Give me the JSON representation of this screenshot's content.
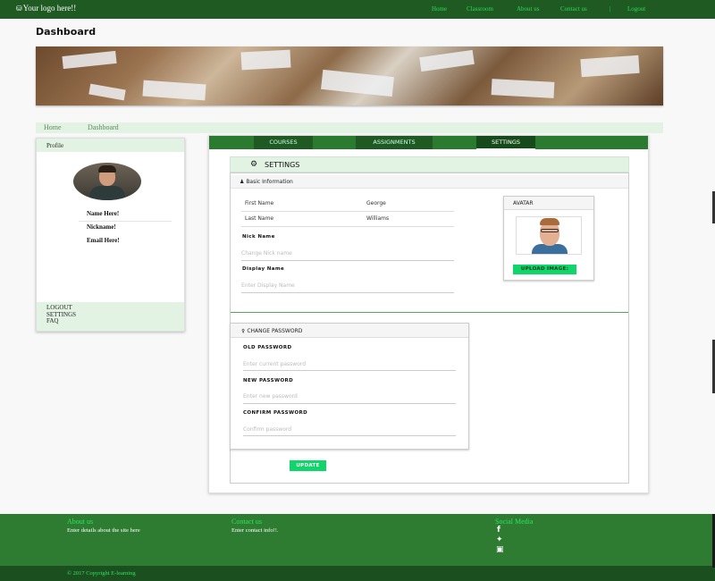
{
  "header": {
    "logo_icon": "car-icon",
    "logo_text": "Your logo here!!",
    "nav": [
      "Home",
      "Classroom",
      "About us",
      "Contact us",
      "|",
      "Logout"
    ]
  },
  "page_title": "Dashboard",
  "breadcrumb": [
    "Home",
    "Dashboard"
  ],
  "profile": {
    "heading": "Profile",
    "name": "Name Here!",
    "nickname": "Nickname!",
    "email": "Email Here!",
    "links": [
      "LOGOUT",
      "SETTINGS",
      "FAQ"
    ]
  },
  "tabs": [
    {
      "label": "COURSES",
      "active": false
    },
    {
      "label": "ASSIGNMENTS",
      "active": false
    },
    {
      "label": "SETTINGS",
      "active": true
    }
  ],
  "settings": {
    "title": "SETTINGS",
    "title_icon": "cogs-icon",
    "basic": {
      "heading": "Basic Information",
      "heading_icon": "user-icon",
      "first_name_label": "First Name",
      "first_name_value": "George",
      "last_name_label": "Last Name",
      "last_name_value": "Williams",
      "nick_label": "Nick Name",
      "nick_placeholder": "Change Nick name",
      "display_label": "Display Name",
      "display_placeholder": "Enter Display Name"
    },
    "avatar": {
      "heading": "AVATAR",
      "upload_label": "UPLOAD IMAGE:"
    },
    "password": {
      "heading": "CHANGE PASSWORD",
      "heading_icon": "key-icon",
      "old_label": "OLD PASSWORD",
      "old_placeholder": "Enter current password",
      "new_label": "NEW PASSWORD",
      "new_placeholder": "Enter new password",
      "confirm_label": "CONFIRM PASSWORD",
      "confirm_placeholder": "Confirm password"
    },
    "update_label": "UPDATE"
  },
  "footer": {
    "about_heading": "About us",
    "about_text": "Enter details about the site here",
    "contact_heading": "Contact us",
    "contact_text": "Enter contact info!!.",
    "social_heading": "Social Media",
    "social_icons": [
      "facebook-icon",
      "twitter-icon",
      "instagram-icon"
    ],
    "copyright": "© 2017 Copyright E-learning"
  },
  "colors": {
    "header_green": "#1e5a22",
    "footer_green": "#2e7b32",
    "accent_green": "#10d56a",
    "light_green": "#e3f3e3"
  }
}
